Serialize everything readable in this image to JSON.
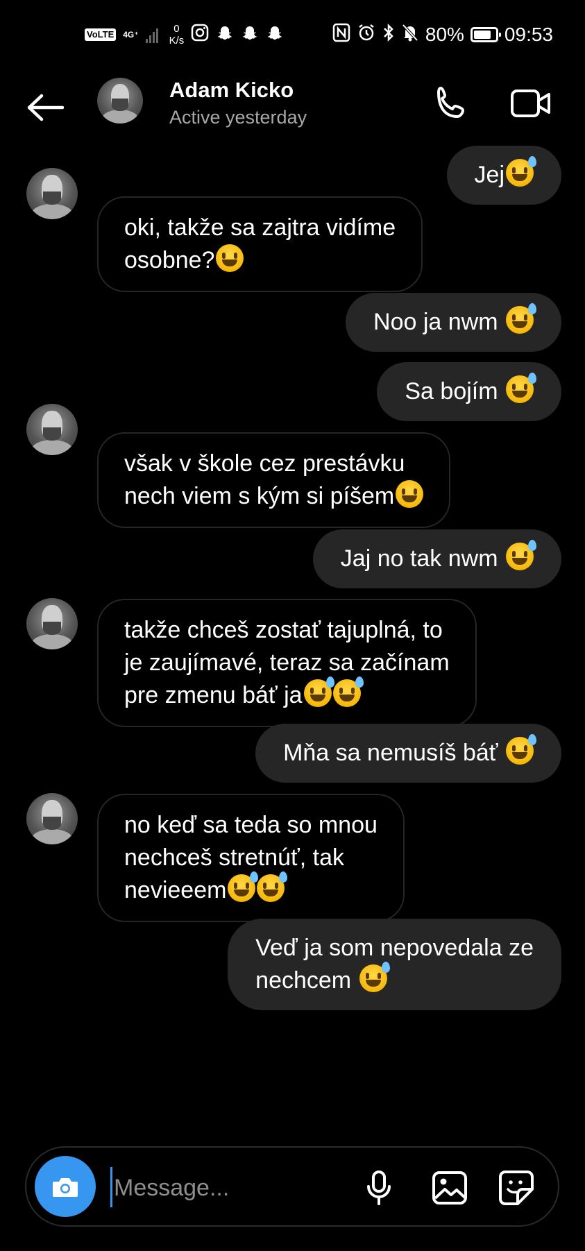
{
  "status_bar": {
    "volte": "VoLTE",
    "network": "4G⁺",
    "speed_value": "0",
    "speed_unit": "K/s",
    "battery": "80%",
    "battery_level": 0.8,
    "time": "09:53",
    "left_icons": [
      "instagram-icon",
      "snapchat-icon",
      "snapchat-icon",
      "snapchat-icon"
    ],
    "right_icons": [
      "nfc-icon",
      "alarm-icon",
      "bluetooth-icon",
      "mute-icon",
      "battery-icon"
    ]
  },
  "header": {
    "name": "Adam Kicko",
    "status": "Active yesterday"
  },
  "messages": [
    {
      "dir": "out",
      "text": "Jej",
      "emojis": [
        "sweat-smile"
      ]
    },
    {
      "dir": "in",
      "lines": [
        "oki, takže sa zajtra vidíme",
        "osobne?"
      ],
      "emojis": [
        "smiley"
      ]
    },
    {
      "dir": "out",
      "text": "Noo ja nwm ",
      "emojis": [
        "sweat-smile"
      ]
    },
    {
      "dir": "out",
      "text": "Sa bojím ",
      "emojis": [
        "sweat-smile"
      ]
    },
    {
      "dir": "in",
      "lines": [
        "však v škole cez prestávku",
        "nech viem s kým si píšem"
      ],
      "emojis": [
        "smiley"
      ]
    },
    {
      "dir": "out",
      "text": "Jaj no tak nwm ",
      "emojis": [
        "sweat-smile"
      ]
    },
    {
      "dir": "in",
      "lines": [
        "takže chceš zostať tajuplná, to",
        "je zaujímavé, teraz sa začínam",
        "pre zmenu báť ja"
      ],
      "emojis": [
        "sweat-smile",
        "sweat-smile"
      ]
    },
    {
      "dir": "out",
      "text": "Mňa sa nemusíš báť ",
      "emojis": [
        "sweat-smile"
      ]
    },
    {
      "dir": "in",
      "lines": [
        "no keď sa teda so mnou",
        "nechceš stretnúť, tak",
        "nevieeem"
      ],
      "emojis": [
        "sweat-smile",
        "sweat-smile"
      ]
    },
    {
      "dir": "out",
      "lines": [
        "Veď ja som nepovedala ze",
        "nechcem "
      ],
      "emojis": [
        "sweat-smile"
      ]
    }
  ],
  "composer": {
    "placeholder": "Message..."
  },
  "colors": {
    "background": "#000000",
    "outgoing_bubble": "#262626",
    "incoming_border": "#262626",
    "accent": "#3797f0",
    "secondary_text": "#a8a8a8"
  }
}
